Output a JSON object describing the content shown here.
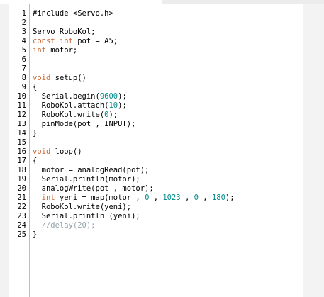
{
  "colors": {
    "keyword": "#cc6633",
    "number": "#008b8b",
    "comment": "#95a3ab",
    "text": "#000000",
    "background": "#ffffff"
  },
  "lines": [
    {
      "n": "1",
      "parts": [
        {
          "t": "#include <Servo.h>",
          "c": "text"
        }
      ]
    },
    {
      "n": "2",
      "parts": []
    },
    {
      "n": "3",
      "parts": [
        {
          "t": "Servo RoboKol;",
          "c": "text"
        }
      ]
    },
    {
      "n": "4",
      "parts": [
        {
          "t": "const",
          "c": "kw"
        },
        {
          "t": " ",
          "c": "text"
        },
        {
          "t": "int",
          "c": "kw"
        },
        {
          "t": " pot = A5;",
          "c": "text"
        }
      ]
    },
    {
      "n": "5",
      "parts": [
        {
          "t": "int",
          "c": "kw"
        },
        {
          "t": " motor;",
          "c": "text"
        }
      ]
    },
    {
      "n": "6",
      "parts": []
    },
    {
      "n": "7",
      "parts": []
    },
    {
      "n": "8",
      "parts": [
        {
          "t": "void",
          "c": "kw"
        },
        {
          "t": " setup()",
          "c": "text"
        }
      ]
    },
    {
      "n": "9",
      "parts": [
        {
          "t": "{",
          "c": "text"
        }
      ]
    },
    {
      "n": "10",
      "parts": [
        {
          "t": "  Serial.begin(",
          "c": "text"
        },
        {
          "t": "9600",
          "c": "num"
        },
        {
          "t": ");",
          "c": "text"
        }
      ]
    },
    {
      "n": "11",
      "parts": [
        {
          "t": "  RoboKol.attach(",
          "c": "text"
        },
        {
          "t": "10",
          "c": "num"
        },
        {
          "t": ");",
          "c": "text"
        }
      ]
    },
    {
      "n": "12",
      "parts": [
        {
          "t": "  RoboKol.write(",
          "c": "text"
        },
        {
          "t": "0",
          "c": "num"
        },
        {
          "t": ");",
          "c": "text"
        }
      ]
    },
    {
      "n": "13",
      "parts": [
        {
          "t": "  pinMode(pot , INPUT);",
          "c": "text"
        }
      ]
    },
    {
      "n": "14",
      "parts": [
        {
          "t": "}",
          "c": "text"
        }
      ]
    },
    {
      "n": "15",
      "parts": []
    },
    {
      "n": "16",
      "parts": [
        {
          "t": "void",
          "c": "kw"
        },
        {
          "t": " loop()",
          "c": "text"
        }
      ]
    },
    {
      "n": "17",
      "parts": [
        {
          "t": "{",
          "c": "text"
        }
      ]
    },
    {
      "n": "18",
      "parts": [
        {
          "t": "  motor = analogRead(pot);",
          "c": "text"
        }
      ]
    },
    {
      "n": "19",
      "parts": [
        {
          "t": "  Serial.println(motor);",
          "c": "text"
        }
      ]
    },
    {
      "n": "20",
      "parts": [
        {
          "t": "  analogWrite(pot , motor);",
          "c": "text"
        }
      ]
    },
    {
      "n": "21",
      "parts": [
        {
          "t": "  ",
          "c": "text"
        },
        {
          "t": "int",
          "c": "kw"
        },
        {
          "t": " yeni = map(motor , ",
          "c": "text"
        },
        {
          "t": "0",
          "c": "num"
        },
        {
          "t": " , ",
          "c": "text"
        },
        {
          "t": "1023",
          "c": "num"
        },
        {
          "t": " , ",
          "c": "text"
        },
        {
          "t": "0",
          "c": "num"
        },
        {
          "t": " , ",
          "c": "text"
        },
        {
          "t": "180",
          "c": "num"
        },
        {
          "t": ");",
          "c": "text"
        }
      ]
    },
    {
      "n": "22",
      "parts": [
        {
          "t": "  RoboKol.write(yeni);",
          "c": "text"
        }
      ]
    },
    {
      "n": "23",
      "parts": [
        {
          "t": "  Serial.println (yeni);",
          "c": "text"
        }
      ]
    },
    {
      "n": "24",
      "parts": [
        {
          "t": "  //delay(20);",
          "c": "comment"
        }
      ]
    },
    {
      "n": "25",
      "parts": [
        {
          "t": "}",
          "c": "text"
        }
      ]
    }
  ]
}
